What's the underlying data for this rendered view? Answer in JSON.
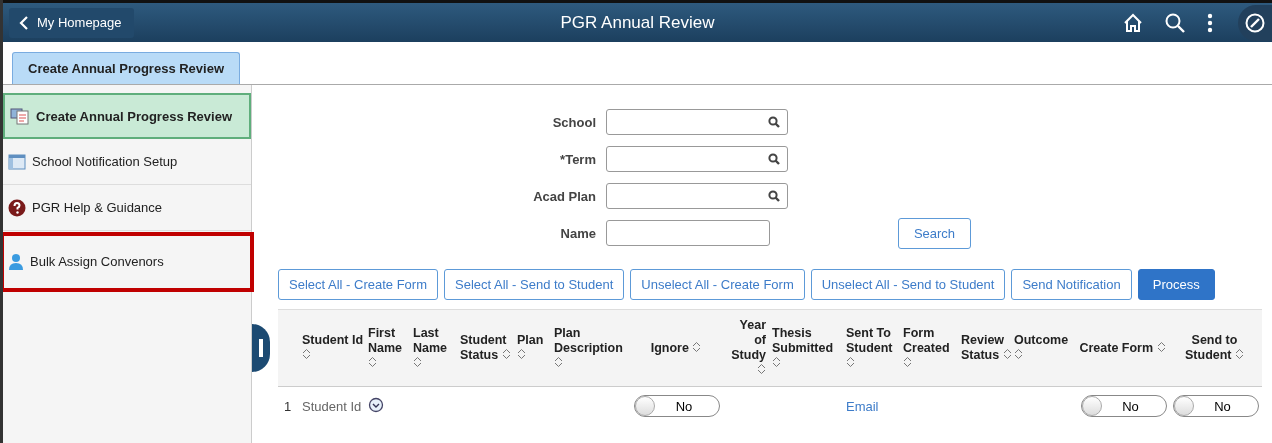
{
  "header": {
    "back_label": "My Homepage",
    "title": "PGR Annual Review"
  },
  "tabs": [
    {
      "label": "Create Annual Progress Review",
      "selected": true
    }
  ],
  "sidebar": {
    "items": [
      {
        "label": "Create Annual Progress Review",
        "kind": "form",
        "selected": true,
        "highlighted": false
      },
      {
        "label": "School Notification Setup",
        "kind": "window",
        "selected": false,
        "highlighted": false
      },
      {
        "label": "PGR Help & Guidance",
        "kind": "help",
        "selected": false,
        "highlighted": false
      },
      {
        "label": "Bulk Assign Convenors",
        "kind": "person",
        "selected": false,
        "highlighted": true
      }
    ]
  },
  "search_form": {
    "fields": [
      {
        "label": "School",
        "lookup": true
      },
      {
        "label": "*Term",
        "lookup": true
      },
      {
        "label": "Acad Plan",
        "lookup": true
      },
      {
        "label": "Name",
        "lookup": false
      }
    ],
    "search_button": "Search"
  },
  "actions": [
    {
      "label": "Select All - Create Form",
      "primary": false
    },
    {
      "label": "Select All - Send to Student",
      "primary": false
    },
    {
      "label": "Unselect All - Create Form",
      "primary": false
    },
    {
      "label": "Unselect All - Send to Student",
      "primary": false
    },
    {
      "label": "Send Notification",
      "primary": false
    },
    {
      "label": "Process",
      "primary": true
    }
  ],
  "table": {
    "columns": [
      {
        "label": "Student Id"
      },
      {
        "label": "First Name"
      },
      {
        "label": "Last Name"
      },
      {
        "label": "Student Status"
      },
      {
        "label": "Plan"
      },
      {
        "label": "Plan Description"
      },
      {
        "label": "Ignore"
      },
      {
        "label": "Year of Study"
      },
      {
        "label": "Thesis Submitted"
      },
      {
        "label": "Sent To Student"
      },
      {
        "label": "Form Created"
      },
      {
        "label": "Review Status"
      },
      {
        "label": "Outcome"
      },
      {
        "label": "Create Form"
      },
      {
        "label": "Send to Student"
      }
    ],
    "rows": [
      {
        "number": "1",
        "student_id": "Student Id",
        "ignore": {
          "label": "No",
          "on": false
        },
        "sent_to_student": "Email",
        "create_form": {
          "label": "No",
          "on": false
        },
        "send_to_student": {
          "label": "No",
          "on": false
        }
      }
    ]
  }
}
